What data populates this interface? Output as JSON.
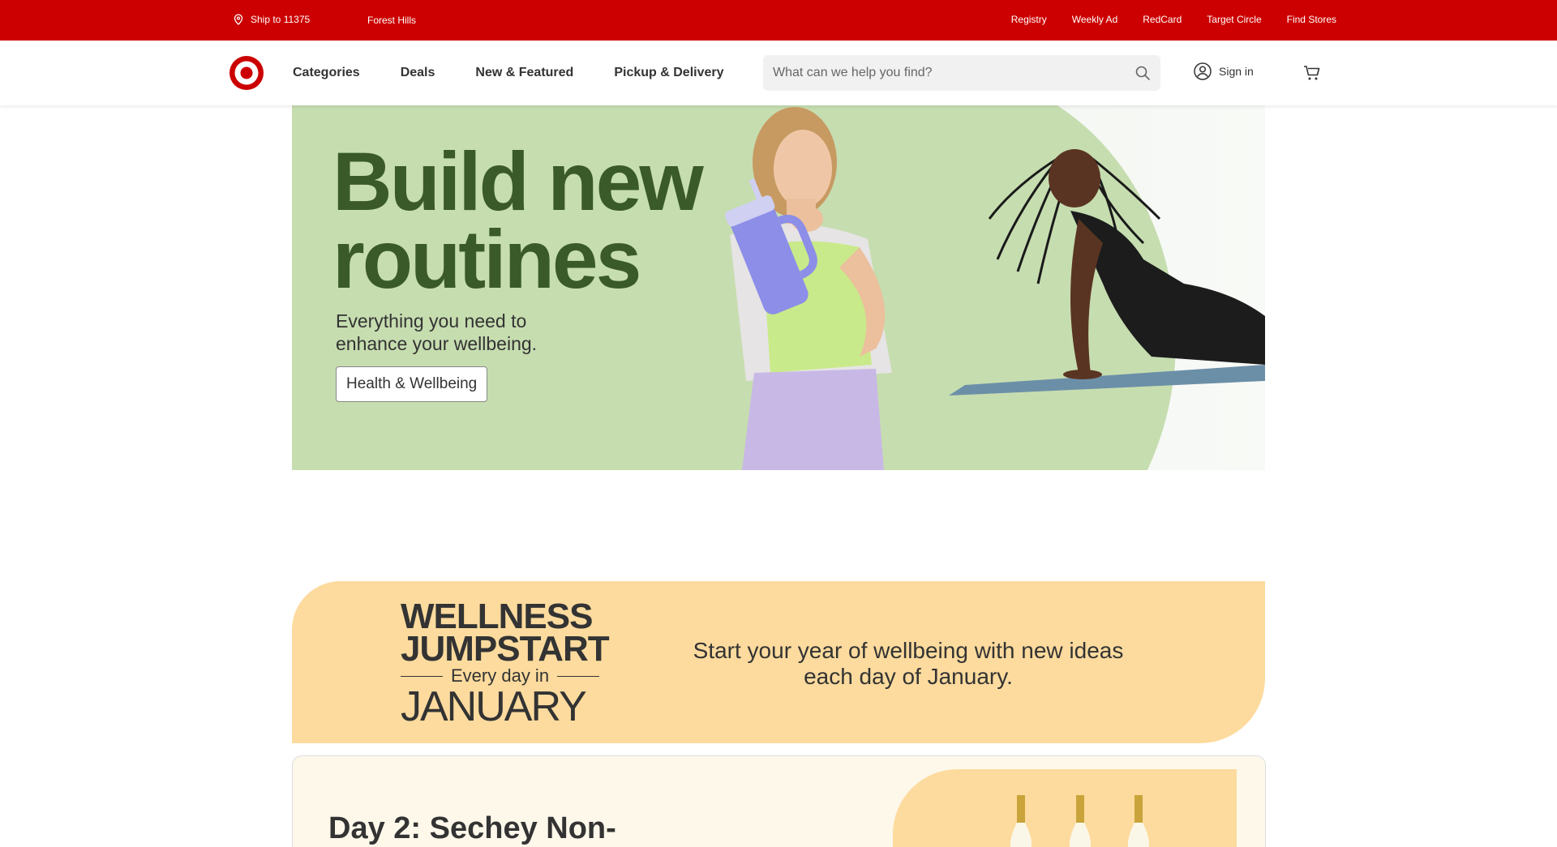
{
  "utility_bar": {
    "ship_label": "Ship to 11375",
    "store_label": "Forest Hills",
    "links": [
      "Registry",
      "Weekly Ad",
      "RedCard",
      "Target Circle",
      "Find Stores"
    ]
  },
  "header": {
    "nav": [
      "Categories",
      "Deals",
      "New & Featured",
      "Pickup & Delivery"
    ],
    "search_placeholder": "What can we help you find?",
    "signin_label": "Sign in"
  },
  "hero": {
    "title_line1": "Build new",
    "title_line2": "routines",
    "subtitle_line1": "Everything you need to",
    "subtitle_line2": "enhance your wellbeing.",
    "button_label": "Health & Wellbeing"
  },
  "wellness": {
    "logo_line1": "WELLNESS",
    "logo_line2": "JUMPSTART",
    "logo_line3": "Every day in",
    "logo_line4": "JANUARY",
    "text_line1": "Start your year of wellbeing with new ideas",
    "text_line2": "each day of January."
  },
  "day_card": {
    "title": "Day 2: Sechey Non-"
  },
  "colors": {
    "brand_red": "#cc0000",
    "hero_green": "#c6ddb0",
    "hero_title": "#3a5a2a",
    "banner_orange": "#fddb9e"
  },
  "icons": [
    "location-pin-icon",
    "target-logo",
    "search-icon",
    "account-icon",
    "cart-icon"
  ]
}
